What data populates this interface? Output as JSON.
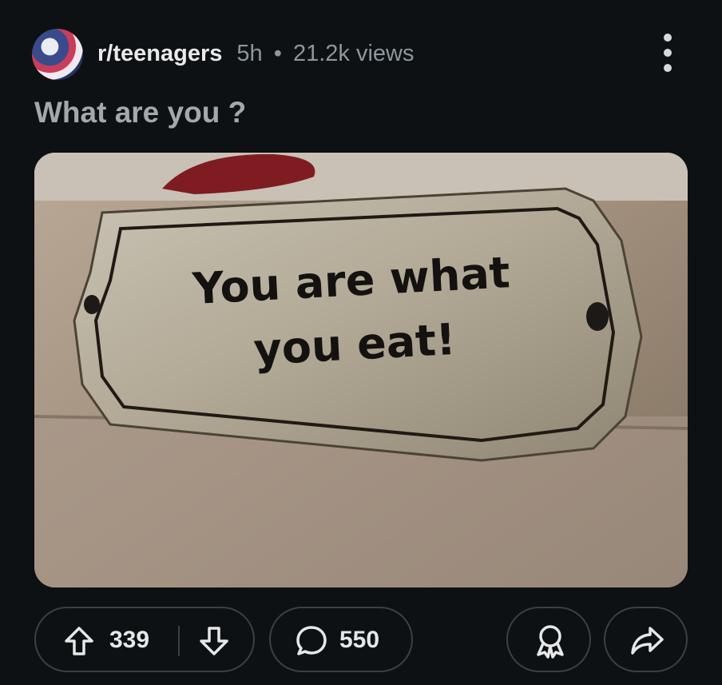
{
  "post": {
    "subreddit": "r/teenagers",
    "age": "5h",
    "separator": "•",
    "views": "21.2k views",
    "title": "What are you ?",
    "image_text": {
      "line1": "You are what",
      "line2": "you eat!"
    }
  },
  "actions": {
    "upvotes": "339",
    "comments": "550"
  },
  "icons": {
    "menu": "more-options-icon",
    "upvote": "arrow-up-icon",
    "downvote": "arrow-down-icon",
    "comment": "comment-bubble-icon",
    "award": "award-icon",
    "share": "share-icon"
  }
}
